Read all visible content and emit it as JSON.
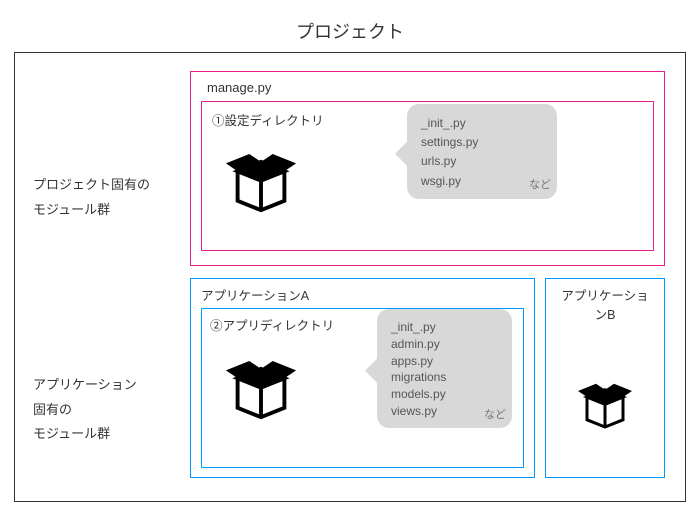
{
  "title": "プロジェクト",
  "sideTop": {
    "line1": "プロジェクト固有の",
    "line2": "モジュール群"
  },
  "sideBottom": {
    "line1": "アプリケーション",
    "line2": "固有の",
    "line3": "モジュール群"
  },
  "managePy": "manage.py",
  "configDirLabel": "①設定ディレクトリ",
  "configFiles": {
    "f1": "_init_.py",
    "f2": "settings.py",
    "f3": "urls.py",
    "f4": "wsgi.py"
  },
  "nado": "など",
  "appA": {
    "title": "アプリケーションA",
    "dirLabel": "②アプリディレクトリ"
  },
  "appFiles": {
    "f1": "_init_.py",
    "f2": "admin.py",
    "f3": "apps.py",
    "f4": "migrations",
    "f5": "models.py",
    "f6": "views.py"
  },
  "appB": {
    "title": "アプリケーションB"
  }
}
